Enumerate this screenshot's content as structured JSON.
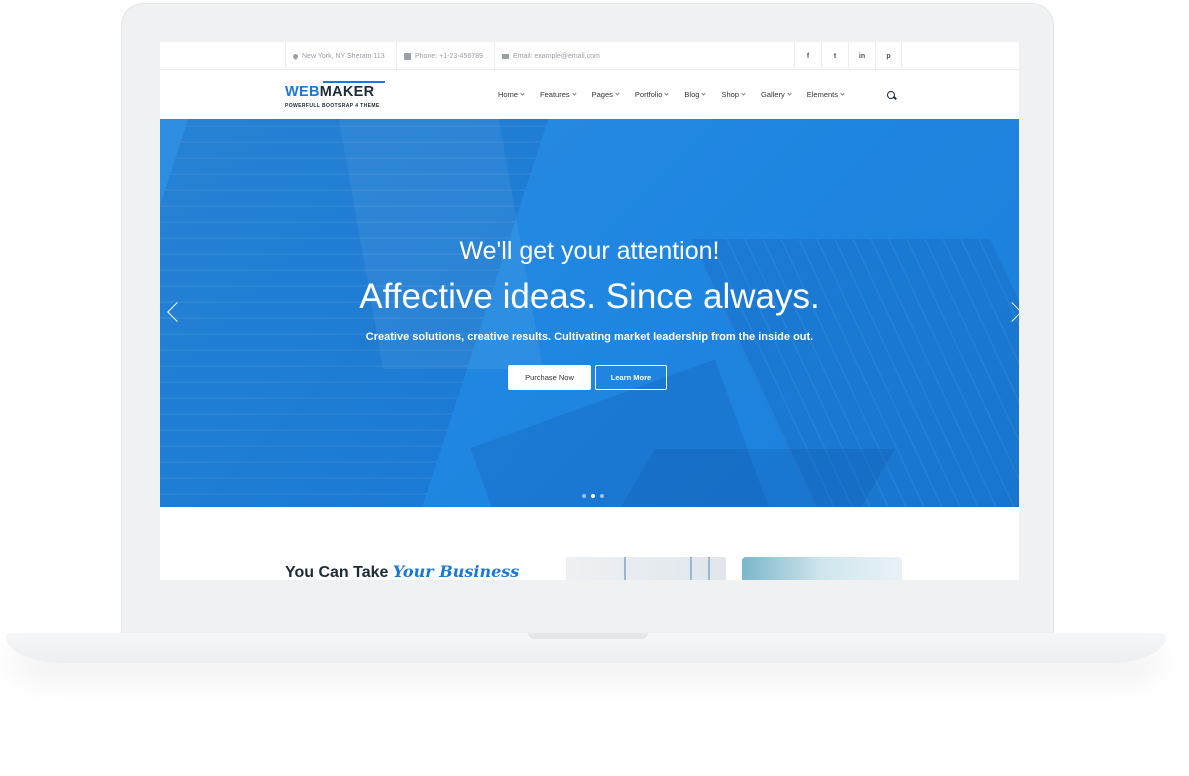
{
  "topbar": {
    "address": "New York, NY Sheram 113",
    "phone": "Phone: +1-23-456789",
    "email": "Email: example@email.com",
    "social_icons": [
      "facebook-icon",
      "twitter-icon",
      "linkedin-icon",
      "pinterest-icon"
    ]
  },
  "logo": {
    "part1": "WEB",
    "part2": "MAKER",
    "tagline": "POWERFULL BOOTSRAP 4 THEME"
  },
  "nav": {
    "items": [
      {
        "label": "Home"
      },
      {
        "label": "Features"
      },
      {
        "label": "Pages"
      },
      {
        "label": "Portfolio"
      },
      {
        "label": "Blog"
      },
      {
        "label": "Shop"
      },
      {
        "label": "Gallery"
      },
      {
        "label": "Elements"
      }
    ]
  },
  "hero": {
    "line1": "We'll get your attention!",
    "line2": "Affective ideas. Since always.",
    "line3": "Creative solutions, creative results. Cultivating market leadership from the inside out.",
    "primary_button": "Purchase Now",
    "secondary_button": "Learn More",
    "active_slide": 2,
    "slide_count": 3
  },
  "section": {
    "title_plain": "You Can Take ",
    "title_emphasis": "Your Business"
  },
  "colors": {
    "accent": "#1a78d6",
    "hero": "#1f86e1",
    "dark": "#1d2b3a"
  }
}
